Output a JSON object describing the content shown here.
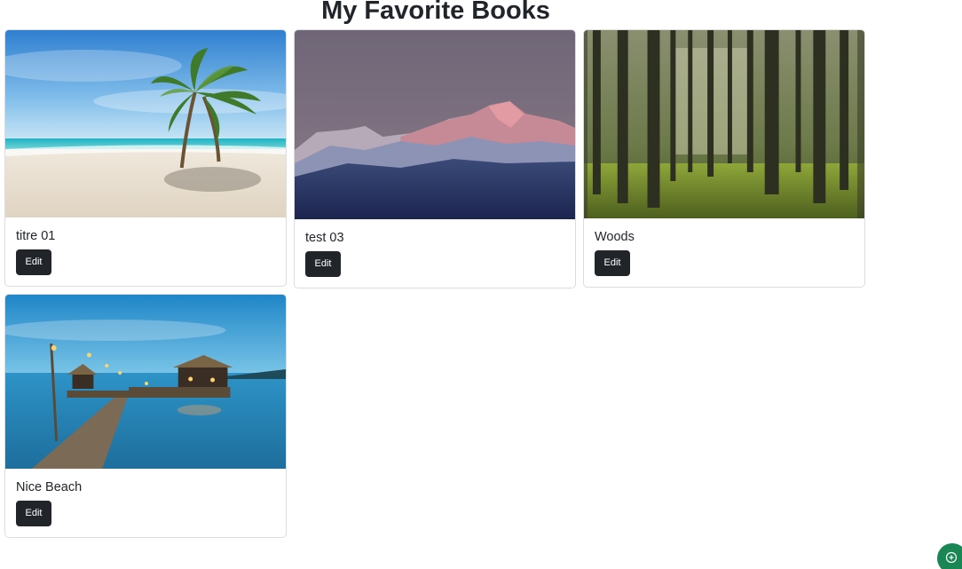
{
  "page": {
    "title": "My Favorite Books"
  },
  "cards": [
    {
      "title": "titre 01",
      "edit_label": "Edit",
      "image": "palm-beach-image"
    },
    {
      "title": "test 03",
      "edit_label": "Edit",
      "image": "mountain-image"
    },
    {
      "title": "Woods",
      "edit_label": "Edit",
      "image": "forest-image"
    },
    {
      "title": "Nice Beach",
      "edit_label": "Edit",
      "image": "pier-beach-image"
    }
  ],
  "colors": {
    "button": "#212529",
    "fab": "#198754"
  },
  "fab": {
    "icon": "add-circle-icon"
  }
}
